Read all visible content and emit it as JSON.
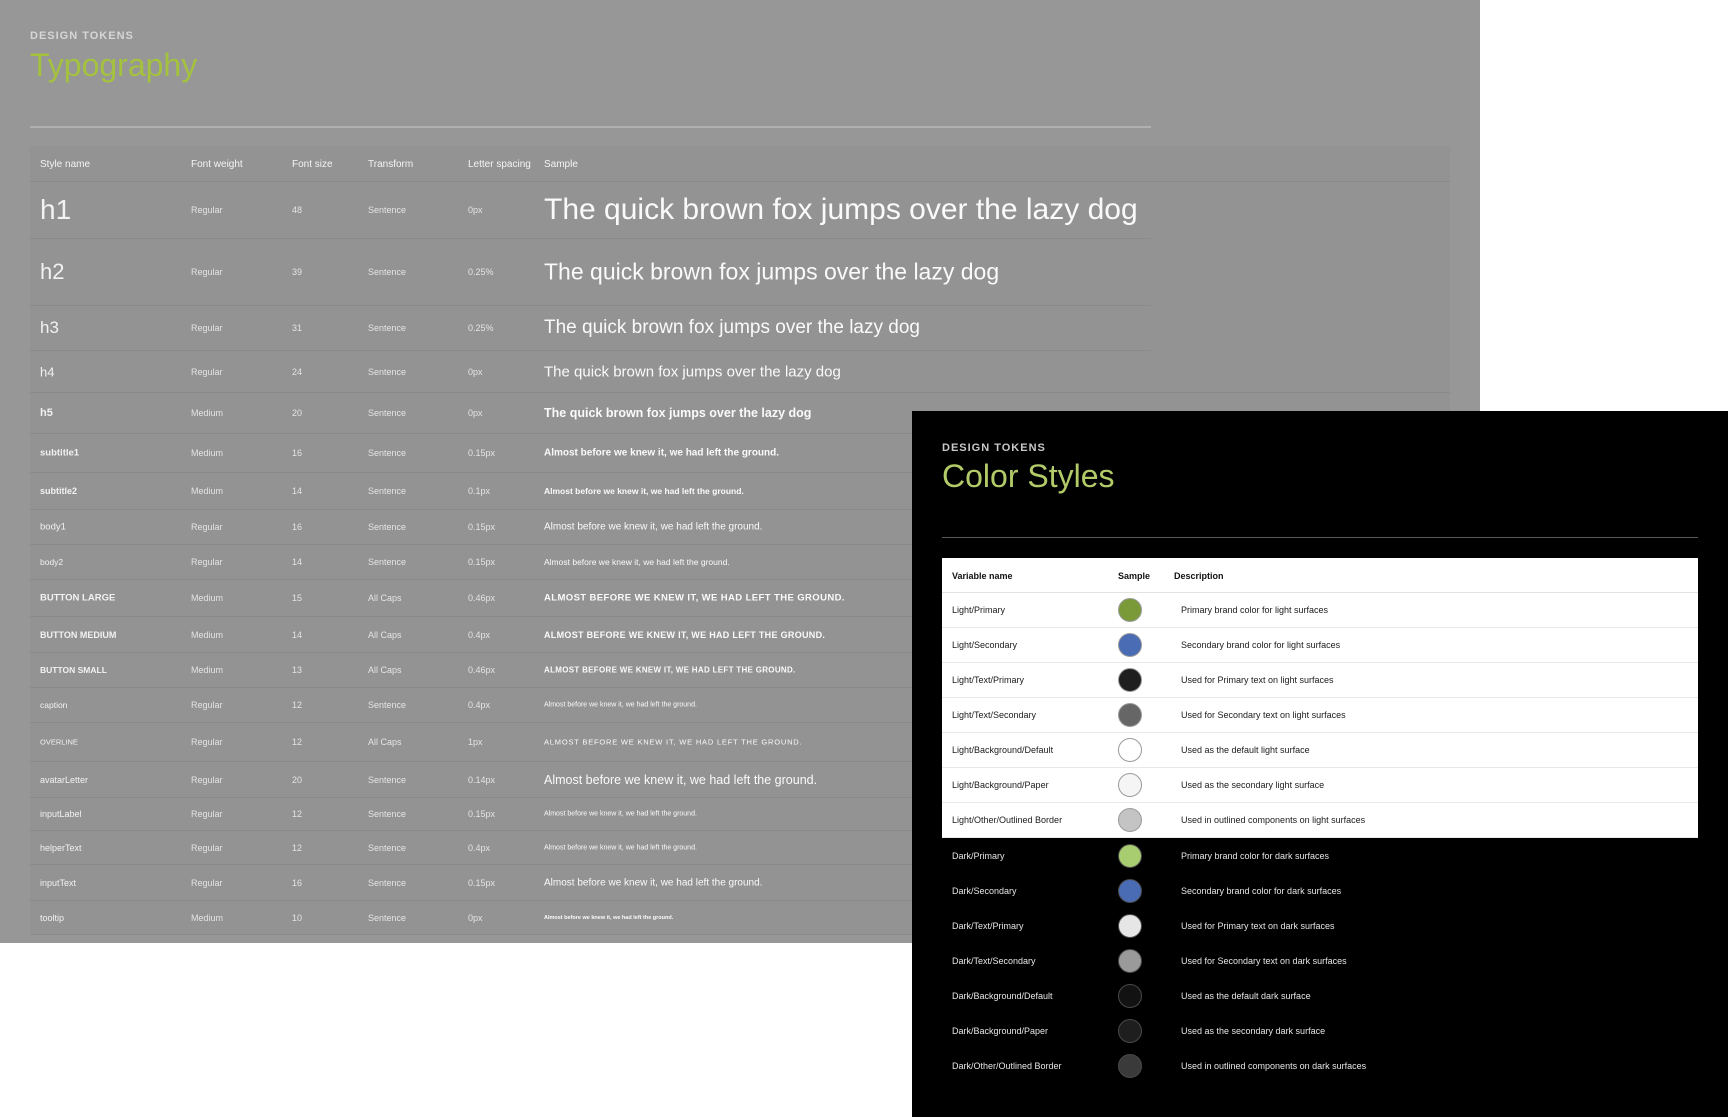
{
  "typography": {
    "kicker": "DESIGN TOKENS",
    "title": "Typography",
    "columns": [
      "Style name",
      "Font weight",
      "Font size",
      "Transform",
      "Letter spacing",
      "Sample"
    ],
    "rows": [
      {
        "name": "h1",
        "weight": "Regular",
        "size": "48",
        "transform": "Sentence",
        "spacing": "0px",
        "sample": "The quick brown fox jumps over the lazy dog"
      },
      {
        "name": "h2",
        "weight": "Regular",
        "size": "39",
        "transform": "Sentence",
        "spacing": "0.25%",
        "sample": "The quick brown fox jumps over the lazy dog"
      },
      {
        "name": "h3",
        "weight": "Regular",
        "size": "31",
        "transform": "Sentence",
        "spacing": "0.25%",
        "sample": "The quick brown fox jumps over the lazy dog"
      },
      {
        "name": "h4",
        "weight": "Regular",
        "size": "24",
        "transform": "Sentence",
        "spacing": "0px",
        "sample": "The quick brown fox jumps over the lazy dog"
      },
      {
        "name": "h5",
        "weight": "Medium",
        "size": "20",
        "transform": "Sentence",
        "spacing": "0px",
        "sample": "The quick brown fox jumps over the lazy dog"
      },
      {
        "name": "subtitle1",
        "weight": "Medium",
        "size": "16",
        "transform": "Sentence",
        "spacing": "0.15px",
        "sample": "Almost before we knew it, we had left the ground."
      },
      {
        "name": "subtitle2",
        "weight": "Medium",
        "size": "14",
        "transform": "Sentence",
        "spacing": "0.1px",
        "sample": "Almost before we knew it, we had left the ground."
      },
      {
        "name": "body1",
        "weight": "Regular",
        "size": "16",
        "transform": "Sentence",
        "spacing": "0.15px",
        "sample": "Almost before we knew it, we had left the ground."
      },
      {
        "name": "body2",
        "weight": "Regular",
        "size": "14",
        "transform": "Sentence",
        "spacing": "0.15px",
        "sample": "Almost before we knew it, we had left the ground."
      },
      {
        "name": "BUTTON LARGE",
        "weight": "Medium",
        "size": "15",
        "transform": "All Caps",
        "spacing": "0.46px",
        "sample": "ALMOST BEFORE WE KNEW IT, WE HAD LEFT THE GROUND."
      },
      {
        "name": "BUTTON MEDIUM",
        "weight": "Medium",
        "size": "14",
        "transform": "All Caps",
        "spacing": "0.4px",
        "sample": "ALMOST BEFORE WE KNEW IT, WE HAD LEFT THE GROUND."
      },
      {
        "name": "BUTTON SMALL",
        "weight": "Medium",
        "size": "13",
        "transform": "All Caps",
        "spacing": "0.46px",
        "sample": "ALMOST BEFORE WE KNEW IT, WE HAD LEFT THE GROUND."
      },
      {
        "name": "caption",
        "weight": "Regular",
        "size": "12",
        "transform": "Sentence",
        "spacing": "0.4px",
        "sample": "Almost before we knew it, we had left the ground."
      },
      {
        "name": "OVERLINE",
        "weight": "Regular",
        "size": "12",
        "transform": "All Caps",
        "spacing": "1px",
        "sample": "ALMOST BEFORE WE KNEW IT, WE HAD LEFT THE GROUND."
      },
      {
        "name": "avatarLetter",
        "weight": "Regular",
        "size": "20",
        "transform": "Sentence",
        "spacing": "0.14px",
        "sample": "Almost before we knew it, we had left the ground."
      },
      {
        "name": "inputLabel",
        "weight": "Regular",
        "size": "12",
        "transform": "Sentence",
        "spacing": "0.15px",
        "sample": "Almost before we knew it, we had left the ground."
      },
      {
        "name": "helperText",
        "weight": "Regular",
        "size": "12",
        "transform": "Sentence",
        "spacing": "0.4px",
        "sample": "Almost before we knew it, we had left the ground."
      },
      {
        "name": "inputText",
        "weight": "Regular",
        "size": "16",
        "transform": "Sentence",
        "spacing": "0.15px",
        "sample": "Almost before we knew it, we had left the ground."
      },
      {
        "name": "tooltip",
        "weight": "Medium",
        "size": "10",
        "transform": "Sentence",
        "spacing": "0px",
        "sample": "Almost before we knew it, we had left the ground."
      }
    ]
  },
  "color_styles": {
    "kicker": "DESIGN TOKENS",
    "title": "Color Styles",
    "columns": [
      "Variable name",
      "Sample",
      "Description"
    ],
    "rows": [
      {
        "name": "Light/Primary",
        "color": "#7a9a3a",
        "description": "Primary brand color for light surfaces",
        "theme": "light"
      },
      {
        "name": "Light/Secondary",
        "color": "#4a6cb5",
        "description": "Secondary brand color for light surfaces",
        "theme": "light"
      },
      {
        "name": "Light/Text/Primary",
        "color": "#1f1f1f",
        "description": "Used for Primary text on light surfaces",
        "theme": "light"
      },
      {
        "name": "Light/Text/Secondary",
        "color": "#666666",
        "description": "Used for Secondary text on light surfaces",
        "theme": "light"
      },
      {
        "name": "Light/Background/Default",
        "color": "#ffffff",
        "description": "Used as the default light surface",
        "theme": "light"
      },
      {
        "name": "Light/Background/Paper",
        "color": "#f5f5f5",
        "description": "Used as the secondary light surface",
        "theme": "light"
      },
      {
        "name": "Light/Other/Outlined Border",
        "color": "#c4c4c4",
        "description": "Used in outlined components on light surfaces",
        "theme": "light"
      },
      {
        "name": "Dark/Primary",
        "color": "#a8cc70",
        "description": "Primary brand color for dark surfaces",
        "theme": "dark"
      },
      {
        "name": "Dark/Secondary",
        "color": "#4a6cb5",
        "description": "Secondary brand color for dark surfaces",
        "theme": "dark"
      },
      {
        "name": "Dark/Text/Primary",
        "color": "#e6e6e6",
        "description": "Used for Primary text on dark surfaces",
        "theme": "dark"
      },
      {
        "name": "Dark/Text/Secondary",
        "color": "#9a9a9a",
        "description": "Used for Secondary text on dark surfaces",
        "theme": "dark"
      },
      {
        "name": "Dark/Background/Default",
        "color": "#121212",
        "description": "Used as the default dark surface",
        "theme": "dark"
      },
      {
        "name": "Dark/Background/Paper",
        "color": "#1e1e1e",
        "description": "Used as the secondary dark surface",
        "theme": "dark"
      },
      {
        "name": "Dark/Other/Outlined Border",
        "color": "#3a3a3a",
        "description": "Used in outlined components on dark surfaces",
        "theme": "dark"
      }
    ]
  }
}
